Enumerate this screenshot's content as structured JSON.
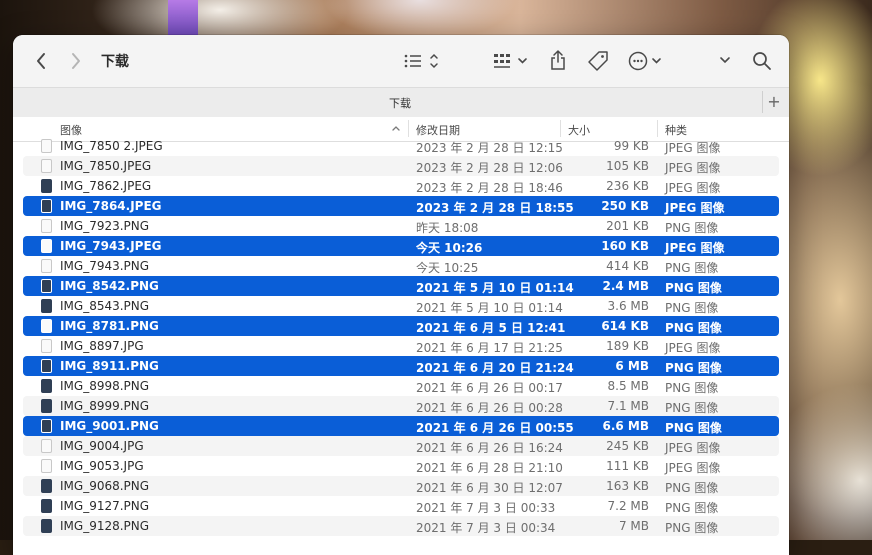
{
  "window": {
    "title": "下载",
    "tab_label": "下载",
    "add_tab": "+"
  },
  "toolbar": {
    "back_icon": "chevron-left-icon",
    "forward_icon": "chevron-right-icon",
    "view_icon": "list-view-icon",
    "group_icon": "grid-group-icon",
    "share_icon": "share-icon",
    "tag_icon": "tag-icon",
    "more_icon": "ellipsis-circle-icon",
    "overflow_icon": "chevron-down-icon",
    "search_icon": "search-icon"
  },
  "columns": {
    "name": "图像",
    "date": "修改日期",
    "size": "大小",
    "kind": "种类"
  },
  "colors": {
    "selection": "#0a5ed7",
    "alt_row": "#f4f4f4"
  },
  "files": [
    {
      "name": "IMG_7850 2.JPEG",
      "date": "2023 年 2 月 28 日 12:15",
      "size": "99 KB",
      "kind": "JPEG 图像",
      "selected": false
    },
    {
      "name": "IMG_7850.JPEG",
      "date": "2023 年 2 月 28 日 12:06",
      "size": "105 KB",
      "kind": "JPEG 图像",
      "selected": false
    },
    {
      "name": "IMG_7862.JPEG",
      "date": "2023 年 2 月 28 日 18:46",
      "size": "236 KB",
      "kind": "JPEG 图像",
      "selected": false
    },
    {
      "name": "IMG_7864.JPEG",
      "date": "2023 年 2 月 28 日 18:55",
      "size": "250 KB",
      "kind": "JPEG 图像",
      "selected": true
    },
    {
      "name": "IMG_7923.PNG",
      "date": "昨天 18:08",
      "size": "201 KB",
      "kind": "PNG 图像",
      "selected": false
    },
    {
      "name": "IMG_7943.JPEG",
      "date": "今天 10:26",
      "size": "160 KB",
      "kind": "JPEG 图像",
      "selected": true
    },
    {
      "name": "IMG_7943.PNG",
      "date": "今天 10:25",
      "size": "414 KB",
      "kind": "PNG 图像",
      "selected": false
    },
    {
      "name": "IMG_8542.PNG",
      "date": "2021 年 5 月 10 日 01:14",
      "size": "2.4 MB",
      "kind": "PNG 图像",
      "selected": true
    },
    {
      "name": "IMG_8543.PNG",
      "date": "2021 年 5 月 10 日 01:14",
      "size": "3.6 MB",
      "kind": "PNG 图像",
      "selected": false
    },
    {
      "name": "IMG_8781.PNG",
      "date": "2021 年 6 月 5 日 12:41",
      "size": "614 KB",
      "kind": "PNG 图像",
      "selected": true
    },
    {
      "name": "IMG_8897.JPG",
      "date": "2021 年 6 月 17 日 21:25",
      "size": "189 KB",
      "kind": "JPEG 图像",
      "selected": false
    },
    {
      "name": "IMG_8911.PNG",
      "date": "2021 年 6 月 20 日 21:24",
      "size": "6 MB",
      "kind": "PNG 图像",
      "selected": true
    },
    {
      "name": "IMG_8998.PNG",
      "date": "2021 年 6 月 26 日 00:17",
      "size": "8.5 MB",
      "kind": "PNG 图像",
      "selected": false
    },
    {
      "name": "IMG_8999.PNG",
      "date": "2021 年 6 月 26 日 00:28",
      "size": "7.1 MB",
      "kind": "PNG 图像",
      "selected": false
    },
    {
      "name": "IMG_9001.PNG",
      "date": "2021 年 6 月 26 日 00:55",
      "size": "6.6 MB",
      "kind": "PNG 图像",
      "selected": true
    },
    {
      "name": "IMG_9004.JPG",
      "date": "2021 年 6 月 26 日 16:24",
      "size": "245 KB",
      "kind": "JPEG 图像",
      "selected": false
    },
    {
      "name": "IMG_9053.JPG",
      "date": "2021 年 6 月 28 日 21:10",
      "size": "111 KB",
      "kind": "JPEG 图像",
      "selected": false
    },
    {
      "name": "IMG_9068.PNG",
      "date": "2021 年 6 月 30 日 12:07",
      "size": "163 KB",
      "kind": "PNG 图像",
      "selected": false
    },
    {
      "name": "IMG_9127.PNG",
      "date": "2021 年 7 月 3 日 00:33",
      "size": "7.2 MB",
      "kind": "PNG 图像",
      "selected": false
    },
    {
      "name": "IMG_9128.PNG",
      "date": "2021 年 7 月 3 日 00:34",
      "size": "7 MB",
      "kind": "PNG 图像",
      "selected": false
    }
  ]
}
